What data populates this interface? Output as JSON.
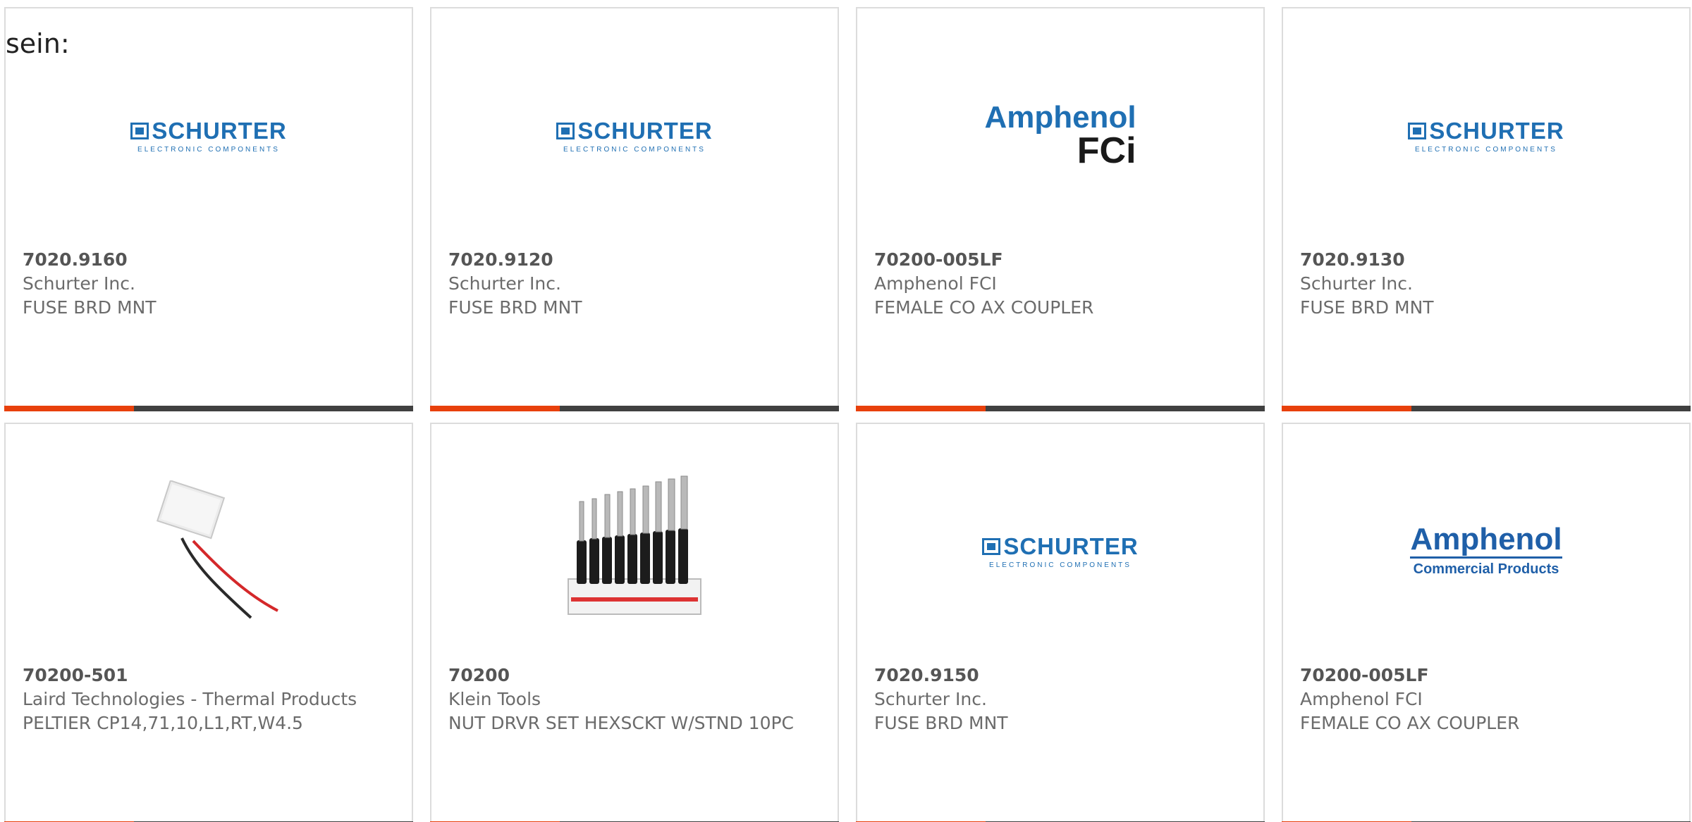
{
  "header": {
    "text": "sein:"
  },
  "colors": {
    "accent": "#e8400c",
    "bar": "#404040",
    "brand_blue": "#1f6fb3"
  },
  "cards": [
    {
      "part": "7020.9160",
      "maker": "Schurter Inc.",
      "desc": "FUSE BRD MNT",
      "logo": "schurter",
      "logo_word": "SCHURTER",
      "logo_sub": "ELECTRONIC COMPONENTS"
    },
    {
      "part": "7020.9120",
      "maker": "Schurter Inc.",
      "desc": "FUSE BRD MNT",
      "logo": "schurter",
      "logo_word": "SCHURTER",
      "logo_sub": "ELECTRONIC COMPONENTS"
    },
    {
      "part": "70200-005LF",
      "maker": "Amphenol FCI",
      "desc": "FEMALE CO AX COUPLER",
      "logo": "amphenol-fci",
      "logo_word": "Amphenol",
      "logo_sub": "FCi"
    },
    {
      "part": "7020.9130",
      "maker": "Schurter Inc.",
      "desc": "FUSE BRD MNT",
      "logo": "schurter",
      "logo_word": "SCHURTER",
      "logo_sub": "ELECTRONIC COMPONENTS"
    },
    {
      "part": "70200-501",
      "maker": "Laird Technologies - Thermal Products",
      "desc": "PELTIER CP14,71,10,L1,RT,W4.5",
      "logo": "peltier-image"
    },
    {
      "part": "70200",
      "maker": "Klein Tools",
      "desc": "NUT DRVR SET HEXSCKT W/STND 10PC",
      "logo": "nut-driver-set-image"
    },
    {
      "part": "7020.9150",
      "maker": "Schurter Inc.",
      "desc": "FUSE BRD MNT",
      "logo": "schurter",
      "logo_word": "SCHURTER",
      "logo_sub": "ELECTRONIC COMPONENTS"
    },
    {
      "part": "70200-005LF",
      "maker": "Amphenol FCI",
      "desc": "FEMALE CO AX COUPLER",
      "logo": "amphenol-commercial",
      "logo_word": "Amphenol",
      "logo_sub": "Commercial Products"
    }
  ]
}
